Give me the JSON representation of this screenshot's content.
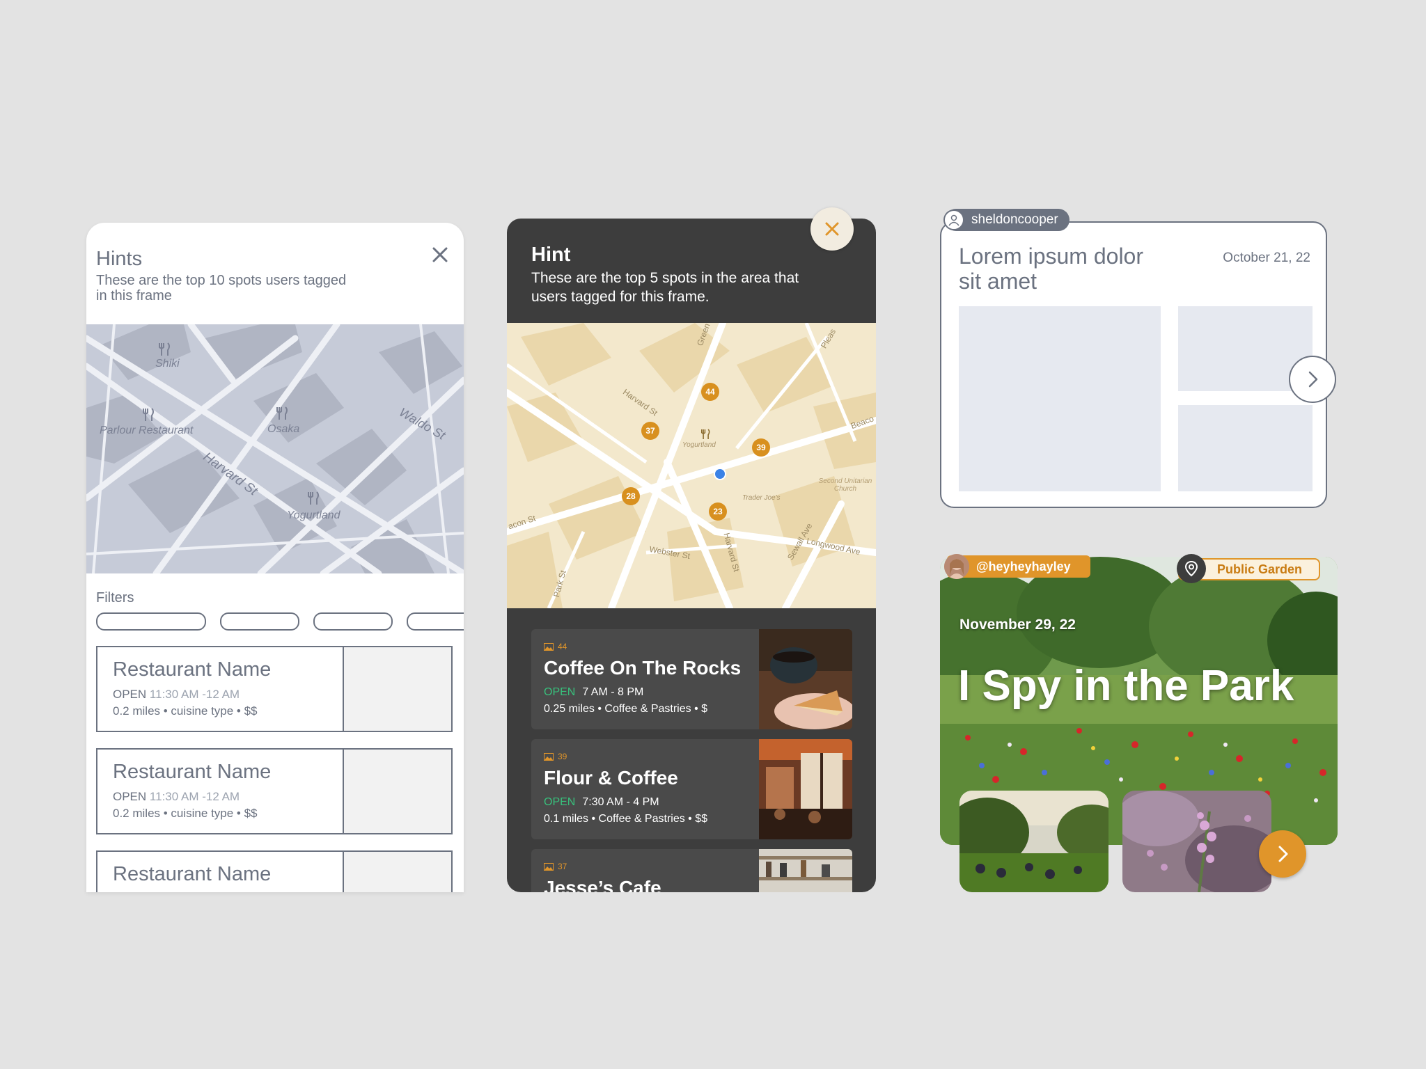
{
  "panel1": {
    "title": "Hints",
    "subtitle": "These are the top 10 spots users tagged in this frame",
    "map_labels": [
      "Shiki",
      "Parlour Restaurant",
      "Osaka",
      "Harvard St",
      "Waldo St",
      "Yogurtland"
    ],
    "filters_label": "Filters",
    "cards": [
      {
        "name": "Restaurant Name",
        "status": "OPEN",
        "hours": "11:30 AM -12 AM",
        "meta": "0.2 miles • cuisine type • $$"
      },
      {
        "name": "Restaurant Name",
        "status": "OPEN",
        "hours": "11:30 AM -12 AM",
        "meta": "0.2 miles • cuisine type • $$"
      },
      {
        "name": "Restaurant Name",
        "status": "",
        "hours": "",
        "meta": ""
      }
    ]
  },
  "panel2": {
    "title": "Hint",
    "subtitle": "These are the top 5 spots in the area that users tagged for this frame.",
    "map_labels": [
      "Green St",
      "Harvard St",
      "Yogurtland",
      "Beaco",
      "Second Unitarian Church",
      "Trader Joe's",
      "acon St",
      "Webster St",
      "Harvard St",
      "Sewall Ave",
      "Longwood Ave",
      "Park St",
      "Pleas"
    ],
    "markers": [
      "44",
      "37",
      "39",
      "28",
      "23"
    ],
    "cards": [
      {
        "count": "44",
        "name": "Coffee On The Rocks",
        "status": "OPEN",
        "hours": "7 AM - 8 PM",
        "meta": "0.25 miles • Coffee & Pastries • $"
      },
      {
        "count": "39",
        "name": "Flour & Coffee",
        "status": "OPEN",
        "hours": "7:30 AM - 4 PM",
        "meta": "0.1 miles • Coffee & Pastries • $$"
      },
      {
        "count": "37",
        "name": "Jesse’s Cafe",
        "status": "",
        "hours": "",
        "meta": ""
      }
    ]
  },
  "panel3": {
    "username": "sheldoncooper",
    "title": "Lorem ipsum dolor sit amet",
    "date": "October 21, 22"
  },
  "panel4": {
    "username": "@heyheyhayley",
    "place": "Public Garden",
    "date": "November 29, 22",
    "headline": "I Spy in the Park"
  },
  "colors": {
    "accent_orange": "#e0952a",
    "open_green": "#38c07c",
    "dark_panel": "#3d3d3d",
    "wire_gray": "#6b7280"
  },
  "icons": [
    "close-icon",
    "fork-knife-icon",
    "image-icon",
    "user-icon",
    "chevron-right-icon",
    "location-pin-icon"
  ]
}
